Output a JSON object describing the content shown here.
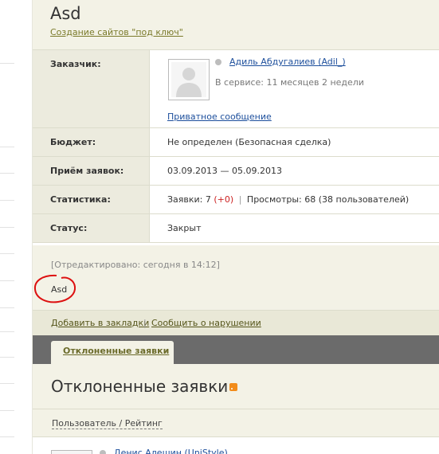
{
  "project": {
    "title": "Asd",
    "category_link": "Создание сайтов \"под ключ\""
  },
  "info": {
    "customer": {
      "label": "Заказчик:",
      "name_link": "Адиль Абдугалиев (Adil_)",
      "service_time": "В сервисе: 11 месяцев 2 недели",
      "private_message_link": "Приватное сообщение",
      "avatar_icon": "user-silhouette-icon"
    },
    "budget": {
      "label": "Бюджет:",
      "value": "Не определен (Безопасная сделка)"
    },
    "bids_period": {
      "label": "Приём заявок:",
      "value": "03.09.2013 — 05.09.2013"
    },
    "stats": {
      "label": "Статистика:",
      "bids_prefix": "Заявки: 7",
      "bids_delta": "(+0)",
      "separator": "|",
      "views": "Просмотры: 68 (38 пользователей)"
    },
    "status": {
      "label": "Статус:",
      "value": "Закрыт"
    }
  },
  "description": {
    "edited_note": "[Отредактировано: сегодня в 14:12]",
    "text": "Asd"
  },
  "actions": {
    "bookmark": "Добавить в закладки",
    "separator": "|",
    "report": "Сообщить о нарушении"
  },
  "tabs": [
    {
      "label": "Отклоненные заявки",
      "active": true
    }
  ],
  "rejected_section": {
    "title": "Отклоненные заявки",
    "rss_icon": "rss-icon",
    "column_header": "Пользователь / Рейтинг",
    "first_user": "Денис Алешин (UniStyle)"
  },
  "colors": {
    "panel_bg": "#f3f2e6",
    "label_bg": "#ecebde",
    "link": "#1d4f9c",
    "tab_bar": "#6b6b6b",
    "delta_red": "#cc2222",
    "annotation_circle": "#dd1111",
    "rss": "#f28c1a"
  }
}
